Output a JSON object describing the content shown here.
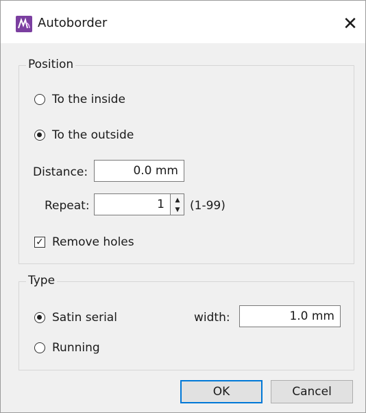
{
  "window": {
    "title": "Autoborder",
    "close_glyph": "✕"
  },
  "position_group": {
    "title": "Position",
    "options": [
      {
        "label": "To the inside",
        "checked": false
      },
      {
        "label": "To the outside",
        "checked": true
      }
    ],
    "distance_label": "Distance:",
    "distance_value": "0.0 mm",
    "repeat_label": "Repeat:",
    "repeat_value": "1",
    "repeat_range": "(1-99)",
    "remove_holes_label": "Remove holes",
    "remove_holes_checked": true
  },
  "type_group": {
    "title": "Type",
    "options": [
      {
        "label": "Satin serial",
        "checked": true
      },
      {
        "label": "Running",
        "checked": false
      }
    ],
    "width_label": "width:",
    "width_value": "1.0 mm"
  },
  "buttons": {
    "ok": "OK",
    "cancel": "Cancel"
  },
  "icons": {
    "app": "app-logo-icon",
    "close": "close-icon",
    "spin_up": "▲",
    "spin_down": "▼",
    "check": "✓"
  },
  "colors": {
    "accent": "#0078d7",
    "app_icon": "#7b3fa0"
  }
}
